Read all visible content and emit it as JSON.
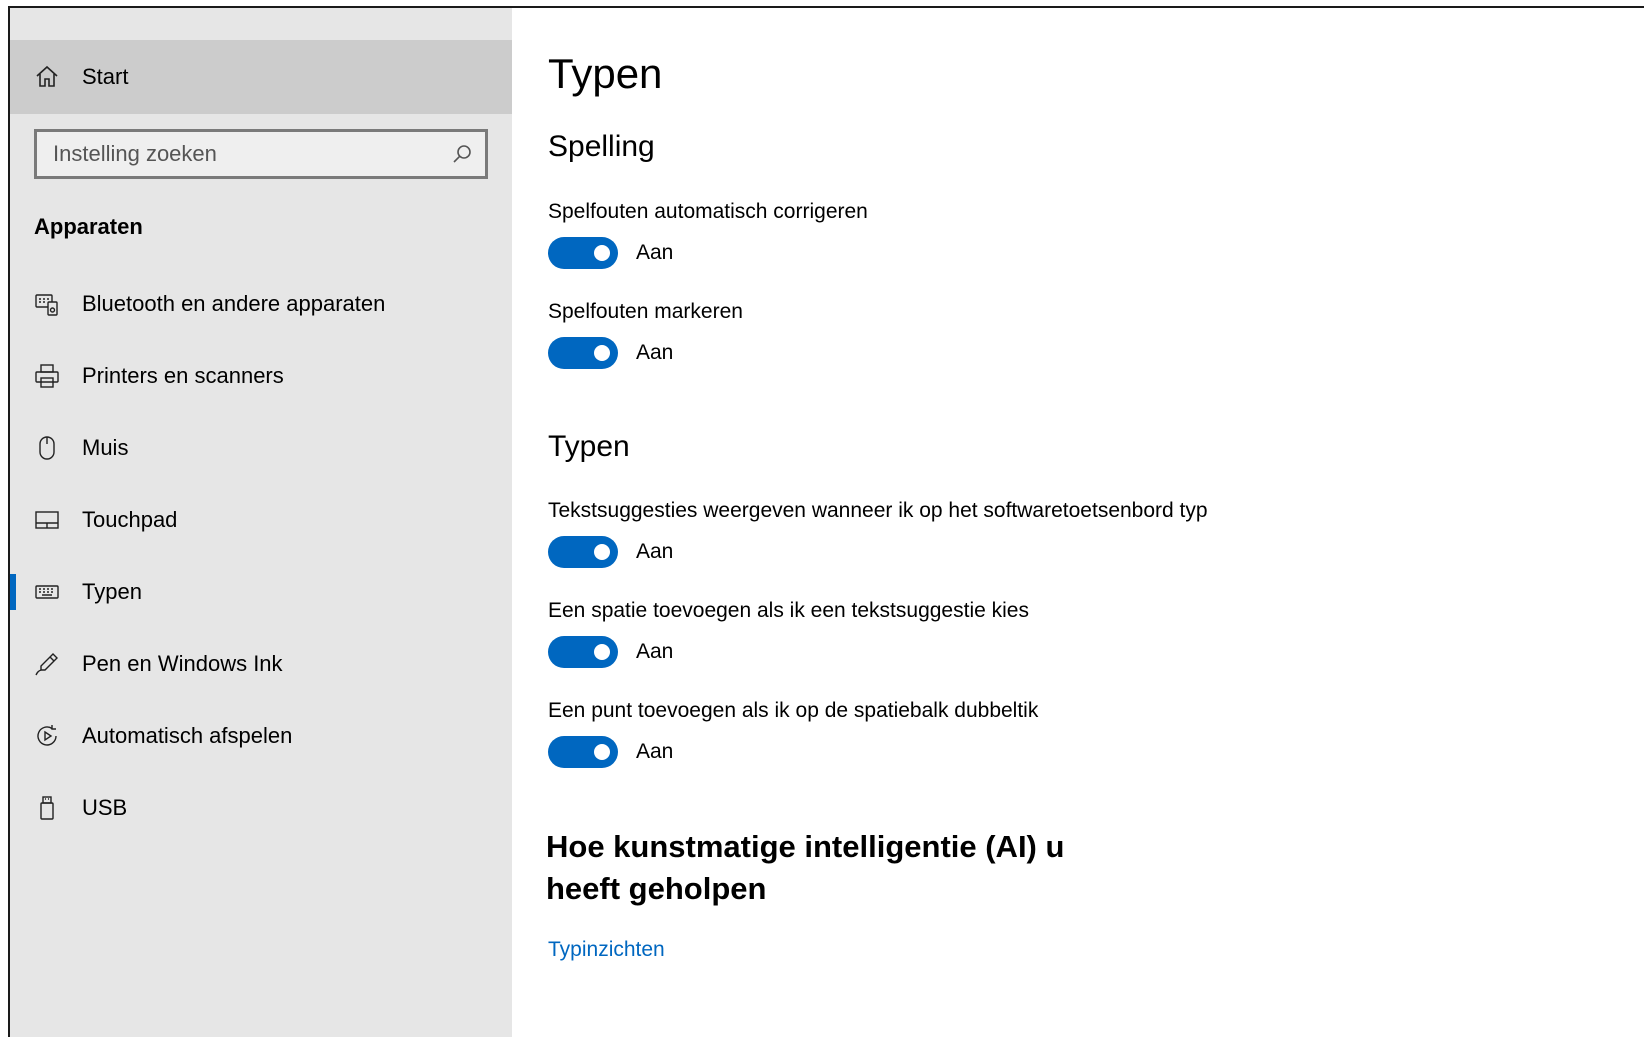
{
  "sidebar": {
    "home_label": "Start",
    "search_placeholder": "Instelling zoeken",
    "category": "Apparaten",
    "items": [
      {
        "label": "Bluetooth en andere apparaten",
        "icon": "bluetooth-devices-icon"
      },
      {
        "label": "Printers en scanners",
        "icon": "printer-icon"
      },
      {
        "label": "Muis",
        "icon": "mouse-icon"
      },
      {
        "label": "Touchpad",
        "icon": "touchpad-icon"
      },
      {
        "label": "Typen",
        "icon": "keyboard-icon",
        "active": true
      },
      {
        "label": "Pen en Windows Ink",
        "icon": "pen-icon"
      },
      {
        "label": "Automatisch afspelen",
        "icon": "autoplay-icon"
      },
      {
        "label": "USB",
        "icon": "usb-icon"
      }
    ]
  },
  "main": {
    "title": "Typen",
    "spelling": {
      "heading": "Spelling",
      "settings": [
        {
          "label": "Spelfouten automatisch corrigeren",
          "state": "Aan",
          "on": true
        },
        {
          "label": "Spelfouten markeren",
          "state": "Aan",
          "on": true
        }
      ]
    },
    "typing": {
      "heading": "Typen",
      "settings": [
        {
          "label": "Tekstsuggesties weergeven wanneer ik op het softwaretoetsenbord typ",
          "state": "Aan",
          "on": true
        },
        {
          "label": "Een spatie toevoegen als ik een tekstsuggestie kies",
          "state": "Aan",
          "on": true
        },
        {
          "label": "Een punt toevoegen als ik op de spatiebalk dubbeltik",
          "state": "Aan",
          "on": true
        }
      ]
    },
    "ai_heading": "Hoe kunstmatige intelligentie (AI) u heeft geholpen",
    "ai_link": "Typinzichten"
  },
  "colors": {
    "accent": "#0067c0",
    "sidebar_bg": "#e6e6e6",
    "home_bg": "#cccccc"
  }
}
